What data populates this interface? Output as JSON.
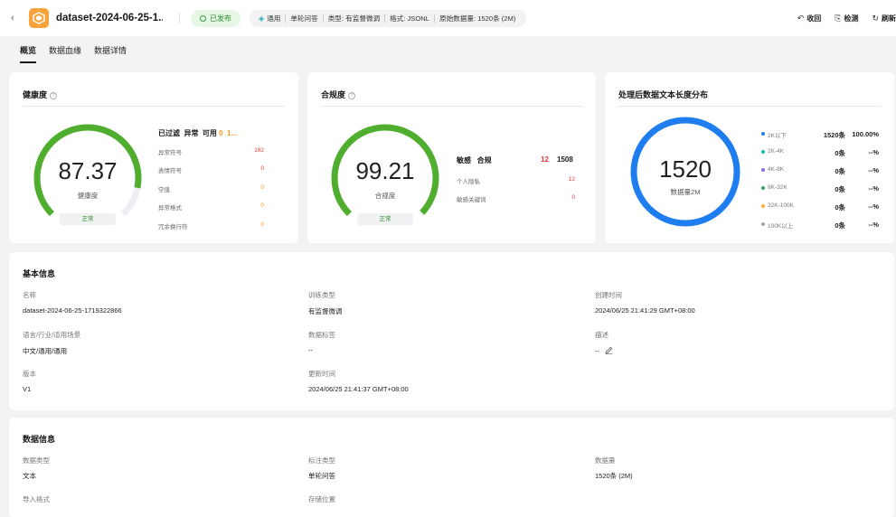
{
  "header": {
    "back_glyph": "‹",
    "title": "dataset-2024-06-25-1...",
    "status": "已发布",
    "tags": {
      "general": "通用",
      "qa": "单轮问答",
      "type": "类型: 有监督微调",
      "format": "格式: JSONL",
      "original": "原始数据量: 1520条 (2M)"
    },
    "actions": {
      "collapse": "收回",
      "check": "检测",
      "refresh": "刷新"
    }
  },
  "tabs": [
    "概览",
    "数据血缘",
    "数据详情"
  ],
  "health": {
    "title": "健康度",
    "value": "87.37",
    "label": "健康度",
    "status": "正常",
    "score_fraction": 0.8737,
    "header": {
      "filtered": "已过滤",
      "abnormal": "异常",
      "usable": "可用",
      "abnormal_value": "0",
      "usable_value": "1..."
    },
    "rows": [
      {
        "name": "异常符号",
        "value": "192"
      },
      {
        "name": "表情符号",
        "value": "0"
      },
      {
        "name": "空值",
        "value": "0"
      },
      {
        "name": "异常格式",
        "value": "0"
      },
      {
        "name": "冗余换行符",
        "value": "0"
      }
    ]
  },
  "compliance": {
    "title": "合规度",
    "value": "99.21",
    "label": "合规度",
    "status": "正常",
    "score_fraction": 0.9921,
    "header": {
      "sensitive": "敏感",
      "compliant": "合规",
      "sensitive_value": "12",
      "compliant_value": "1508"
    },
    "rows": [
      {
        "name": "个人隐私",
        "value": "12"
      },
      {
        "name": "敏感关键词",
        "value": "0"
      }
    ]
  },
  "distribution": {
    "title": "处理后数据文本长度分布",
    "value": "1520",
    "label": "数据量2M",
    "ring_color": "#1e7ef0",
    "rows": [
      {
        "name": "2K以下",
        "count": "1520条",
        "pct": "100.00%",
        "color": "#1e7ef0"
      },
      {
        "name": "2K-4K",
        "count": "0条",
        "pct": "--%",
        "color": "#19b7b7"
      },
      {
        "name": "4K-8K",
        "count": "0条",
        "pct": "--%",
        "color": "#8b6cf0"
      },
      {
        "name": "8K-32K",
        "count": "0条",
        "pct": "--%",
        "color": "#3aa757"
      },
      {
        "name": "32K-100K",
        "count": "0条",
        "pct": "--%",
        "color": "#f2b233"
      },
      {
        "name": "100K以上",
        "count": "0条",
        "pct": "--%",
        "color": "#a0a4ab"
      }
    ]
  },
  "basic": {
    "title": "基本信息",
    "fields": {
      "name_label": "名称",
      "name_value": "dataset-2024-06-25-1719322866",
      "train_label": "训练类型",
      "train_value": "有监督微调",
      "created_label": "创建时间",
      "created_value": "2024/06/25 21:41:29 GMT+08:00",
      "lang_label": "语言/行业/适用场景",
      "lang_value": "中文/通用/通用",
      "tag_label": "数据标签",
      "tag_value": "--",
      "desc_label": "描述",
      "desc_value": "--",
      "version_label": "版本",
      "version_value": "V1",
      "updated_label": "更新时间",
      "updated_value": "2024/06/25 21:41:37 GMT+08:00"
    }
  },
  "datainfo": {
    "title": "数据信息",
    "fields": {
      "dtype_label": "数据类型",
      "dtype_value": "文本",
      "anno_label": "标注类型",
      "anno_value": "单轮问答",
      "volume_label": "数据量",
      "volume_value": "1520条 (2M)",
      "import_label": "导入格式",
      "storage_label": "存储位置"
    }
  },
  "colors": {
    "green": "#4fae2e",
    "track": "#eceef1",
    "red": "#e23b3b",
    "orange": "#f0a020"
  }
}
